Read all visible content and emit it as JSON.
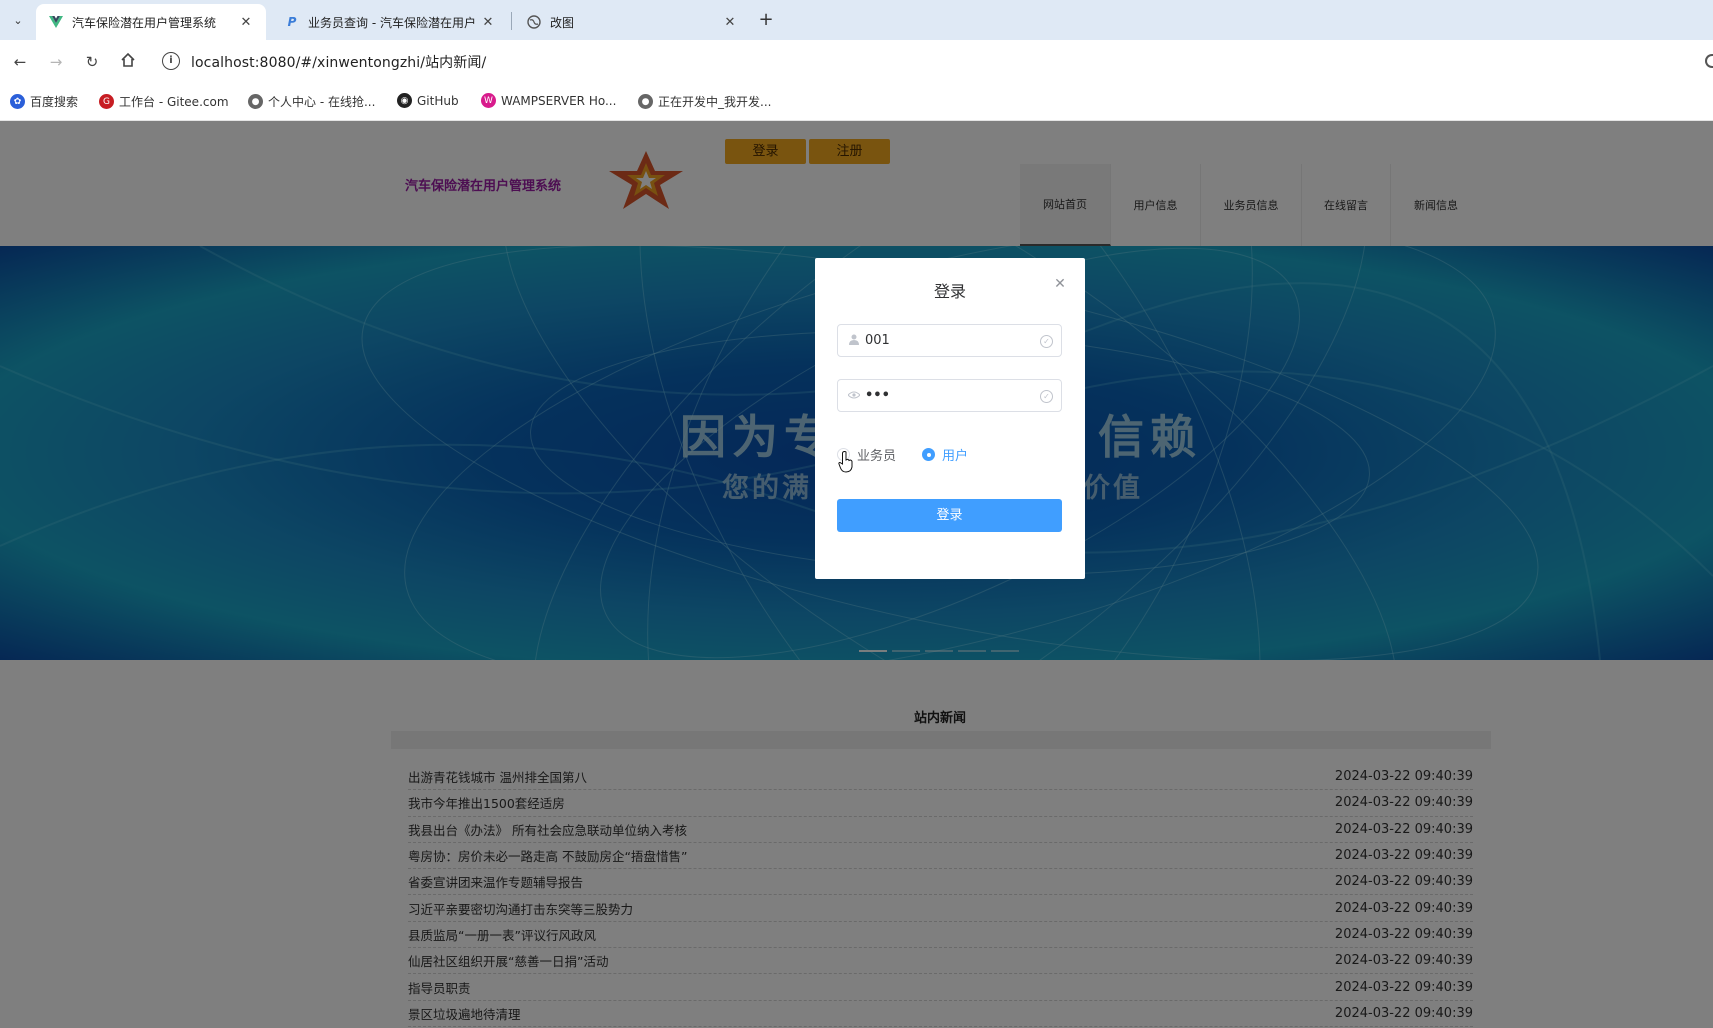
{
  "browser": {
    "tabs": [
      {
        "title": "汽车保险潜在用户管理系统",
        "active": true,
        "icon": "vue-icon"
      },
      {
        "title": "业务员查询 - 汽车保险潜在用户",
        "active": false,
        "icon": "p-icon"
      },
      {
        "title": "改图",
        "active": false,
        "icon": "globe-icon"
      }
    ],
    "url": "localhost:8080/#/xinwentongzhi/站内新闻/",
    "bookmarks": [
      {
        "label": "百度搜索",
        "icon": "baidu-icon"
      },
      {
        "label": "工作台 - Gitee.com",
        "icon": "gitee-icon"
      },
      {
        "label": "个人中心 - 在线抢...",
        "icon": "globe-icon"
      },
      {
        "label": "GitHub",
        "icon": "github-icon"
      },
      {
        "label": "WAMPSERVER Ho...",
        "icon": "wamp-icon"
      },
      {
        "label": "正在开发中_我开发...",
        "icon": "globe-icon"
      }
    ]
  },
  "site": {
    "login_label": "登录",
    "register_label": "注册",
    "title": "汽车保险潜在用户管理系统",
    "menu": [
      {
        "label": "网站首页",
        "active": true
      },
      {
        "label": "用户信息",
        "active": false
      },
      {
        "label": "业务员信息",
        "active": false
      },
      {
        "label": "在线留言",
        "active": false
      },
      {
        "label": "新闻信息",
        "active": false
      }
    ]
  },
  "banner": {
    "line1_left": "因为专",
    "line1_right": "信赖",
    "line2_left": "您的满",
    "line2_right": "价值",
    "slide_count": 5,
    "active_slide": 0
  },
  "news": {
    "title": "站内新闻",
    "items": [
      {
        "title": "出游青花钱城市 温州排全国第八",
        "date": "2024-03-22 09:40:39"
      },
      {
        "title": "我市今年推出1500套经适房",
        "date": "2024-03-22 09:40:39"
      },
      {
        "title": "我县出台《办法》 所有社会应急联动单位纳入考核",
        "date": "2024-03-22 09:40:39"
      },
      {
        "title": "粤房协：房价未必一路走高 不鼓励房企“捂盘惜售”",
        "date": "2024-03-22 09:40:39"
      },
      {
        "title": "省委宣讲团来温作专题辅导报告",
        "date": "2024-03-22 09:40:39"
      },
      {
        "title": "习近平亲要密切沟通打击东突等三股势力",
        "date": "2024-03-22 09:40:39"
      },
      {
        "title": "县质监局“一册一表”评议行风政风",
        "date": "2024-03-22 09:40:39"
      },
      {
        "title": "仙居社区组织开展“慈善一日捐”活动",
        "date": "2024-03-22 09:40:39"
      },
      {
        "title": "指导员职责",
        "date": "2024-03-22 09:40:39"
      },
      {
        "title": "景区垃圾遍地待清理",
        "date": "2024-03-22 09:40:39"
      }
    ]
  },
  "login_dialog": {
    "title": "登录",
    "username_value": "001",
    "password_value": "•••",
    "roles": [
      {
        "label": "业务员",
        "checked": false
      },
      {
        "label": "用户",
        "checked": true
      }
    ],
    "submit_label": "登录"
  },
  "colors": {
    "primary": "#409eff",
    "top_button": "#f3a91f",
    "site_title": "#9b1ca5",
    "logo_star": "#d8542a"
  }
}
